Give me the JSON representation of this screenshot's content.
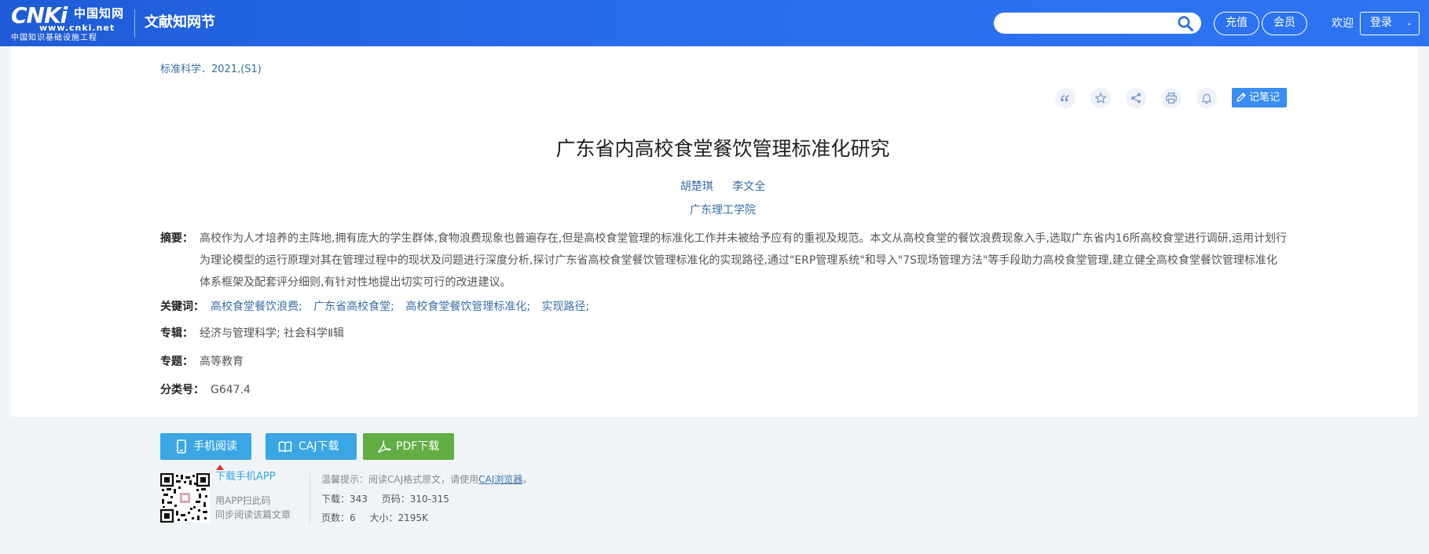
{
  "header": {
    "logo_main": "CNKi",
    "logo_cn": "中国知网",
    "logo_url": "www.cnki.net",
    "logo_sub": "中国知识基础设施工程",
    "site_name": "文献知网节",
    "search_placeholder": "",
    "recharge_label": "充值",
    "member_label": "会员",
    "welcome": "欢迎",
    "login_label": "登录"
  },
  "article": {
    "source": "标准科学．2021,(S1)",
    "note_label": "记笔记",
    "title": "广东省内高校食堂餐饮管理标准化研究",
    "authors": [
      "胡楚琪",
      "李文全"
    ],
    "organization": "广东理工学院",
    "abstract_label": "摘要：",
    "abstract": "高校作为人才培养的主阵地,拥有庞大的学生群体,食物浪费现象也普遍存在,但是高校食堂管理的标准化工作并未被给予应有的重视及规范。本文从高校食堂的餐饮浪费现象入手,选取广东省内16所高校食堂进行调研,运用计划行为理论模型的运行原理对其在管理过程中的现状及问题进行深度分析,探讨广东省高校食堂餐饮管理标准化的实现路径,通过\"ERP管理系统\"和导入\"7S现场管理方法\"等手段助力高校食堂管理,建立健全高校食堂餐饮管理标准化体系框架及配套评分细则,有针对性地提出切实可行的改进建议。",
    "keywords_label": "关键词：",
    "keywords": [
      "高校食堂餐饮浪费;",
      "广东省高校食堂;",
      "高校食堂餐饮管理标准化;",
      "实现路径;"
    ],
    "album_label": "专辑：",
    "album": "经济与管理科学; 社会科学Ⅱ辑",
    "topic_label": "专题：",
    "topic": "高等教育",
    "class_label": "分类号：",
    "class_no": "G647.4"
  },
  "download": {
    "mobile_label": "手机阅读",
    "caj_label": "CAJ下载",
    "pdf_label": "PDF下载",
    "app_link": "下载手机APP",
    "app_tip1": "用APP扫此码",
    "app_tip2": "同步阅读该篇文章",
    "hint_prefix": "温馨提示：阅读CAJ格式原文，请使用",
    "hint_link": "CAJ浏览器",
    "hint_suffix": "。",
    "downloads": "下载：343",
    "pages_range": "页码：310-315",
    "page_count": "页数：6",
    "size": "大小：2195K"
  },
  "colors": {
    "header_blue": "#2a6ef0",
    "link_blue": "#3b6ea5",
    "button_blue": "#3aa6e3",
    "pdf_green": "#62ad44",
    "note_blue": "#3a8df2"
  }
}
